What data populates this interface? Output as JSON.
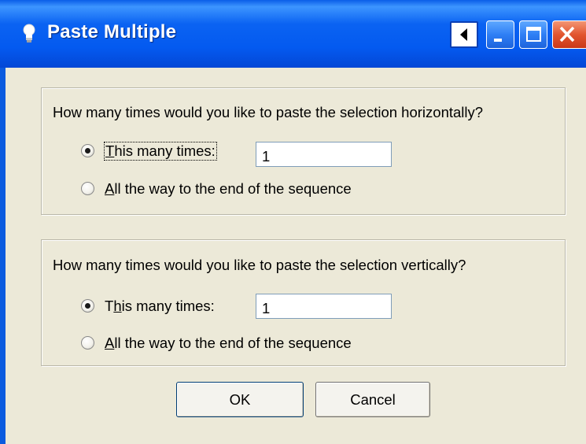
{
  "window": {
    "title": "Paste Multiple"
  },
  "horizontal": {
    "question": "How many times would you like to paste the selection horizontally?",
    "opt_many": {
      "key": "T",
      "rest": "his many times:",
      "checked": true
    },
    "opt_end": {
      "key": "A",
      "rest": "ll the way to the end of the sequence",
      "checked": false
    },
    "value": "1"
  },
  "vertical": {
    "question": "How many times would you like to paste the selection vertically?",
    "opt_many": {
      "pre": "T",
      "key": "h",
      "rest": "is many times:",
      "checked": true
    },
    "opt_end": {
      "key": "A",
      "rest": "ll the way to the end of the sequence",
      "checked": false
    },
    "value": "1"
  },
  "buttons": {
    "ok": "OK",
    "cancel": "Cancel"
  },
  "icons": {
    "title": "lightbulb-icon",
    "back": "arrow-left-icon",
    "minimize": "minimize-icon",
    "maximize": "maximize-icon",
    "close": "close-icon"
  }
}
